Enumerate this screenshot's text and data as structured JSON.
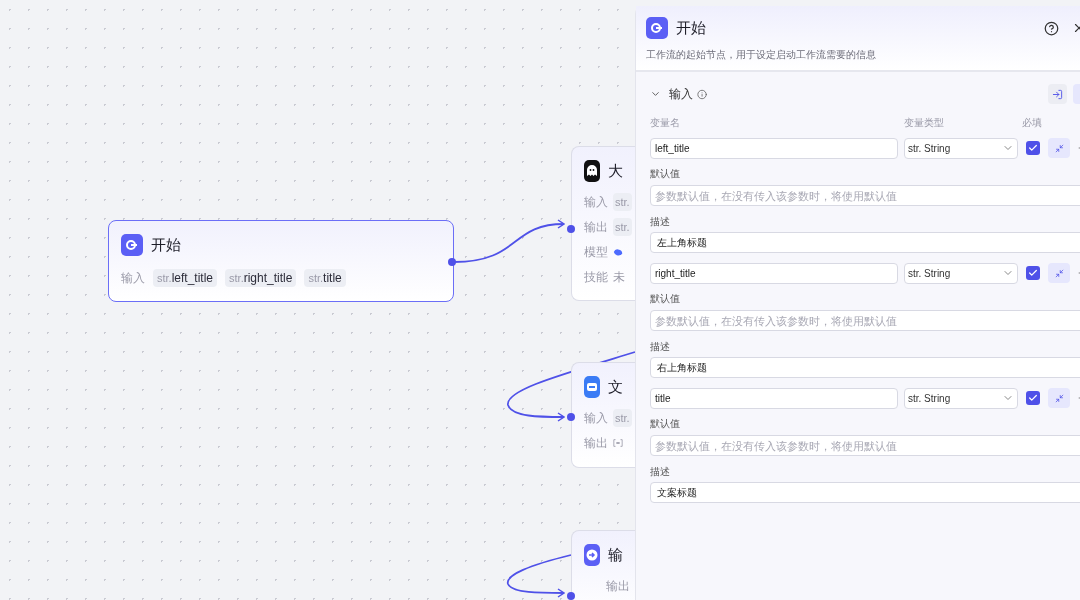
{
  "canvas": {
    "nodes": [
      {
        "kind": "start",
        "title": "开始",
        "rows": [
          {
            "label": "输入",
            "chips": [
              {
                "prefix": "str.",
                "name": "left_title"
              },
              {
                "prefix": "str.",
                "name": "right_title"
              },
              {
                "prefix": "str.",
                "name": "title"
              }
            ]
          }
        ]
      },
      {
        "kind": "llm",
        "title": "大",
        "rows": [
          {
            "label": "输入",
            "kind": "chips",
            "chips": [
              {
                "prefix": "str."
              }
            ]
          },
          {
            "label": "输出",
            "kind": "chips",
            "chips": [
              {
                "prefix": "str."
              }
            ]
          },
          {
            "label": "模型",
            "kind": "model"
          },
          {
            "label": "技能",
            "kind": "value",
            "value": "未"
          }
        ]
      },
      {
        "kind": "text",
        "title": "文",
        "rows": [
          {
            "label": "输入",
            "kind": "chips",
            "chips": [
              {
                "prefix": "str."
              }
            ]
          },
          {
            "label": "输出",
            "kind": "array"
          }
        ]
      },
      {
        "kind": "end",
        "title": "输",
        "rows": [
          {
            "label": "输出"
          }
        ]
      }
    ]
  },
  "panel": {
    "title": "开始",
    "description": "工作流的起始节点，用于设定启动工作流需要的信息",
    "section": {
      "title": "输入",
      "expanded": true,
      "columns": [
        "变量名",
        "变量类型",
        "必填"
      ],
      "variables": [
        {
          "name": "left_title",
          "type": "str. String",
          "required": true,
          "default_label": "默认值",
          "default_placeholder": "参数默认值，在没有传入该参数时，将使用默认值",
          "description_label": "描述",
          "description": "左上角标题"
        },
        {
          "name": "right_title",
          "type": "str. String",
          "required": true,
          "default_label": "默认值",
          "default_placeholder": "参数默认值，在没有传入该参数时，将使用默认值",
          "description_label": "描述",
          "description": "右上角标题"
        },
        {
          "name": "title",
          "type": "str. String",
          "required": true,
          "default_label": "默认值",
          "default_placeholder": "参数默认值，在没有传入该参数时，将使用默认值",
          "description_label": "描述",
          "description": "文案标题"
        }
      ]
    }
  }
}
